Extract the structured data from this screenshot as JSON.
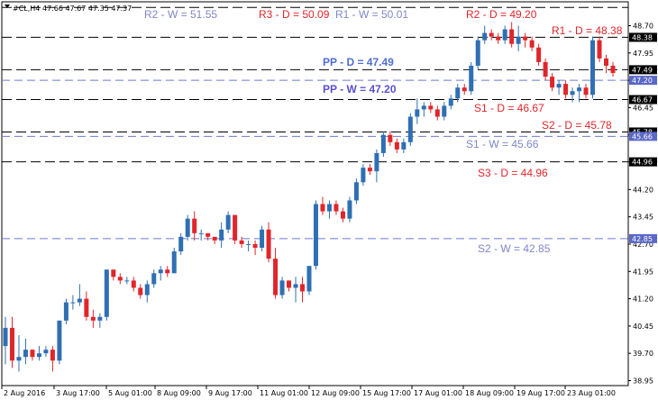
{
  "header": {
    "symbol": "#CL,H4",
    "ohlc": "47.66 47.67 47.35 47.37"
  },
  "colors": {
    "bull": "#2f6fb3",
    "bear": "#e0262b",
    "daily_line": "#000000",
    "weekly_line": "#6b7bd3",
    "daily_text": "#e0262b",
    "weekly_text": "#7f86c9",
    "pp_daily_text": "#4f6fd3",
    "pp_weekly_text": "#5a4fd0",
    "box_fill": "#000000",
    "box_weekly_fill": "#5a68c6"
  },
  "chart_data": {
    "type": "candlestick",
    "symbol": "#CL",
    "timeframe": "H4",
    "ylim": [
      38.95,
      49.1
    ],
    "y_ticks": [
      "48.70",
      "47.95",
      "47.20",
      "46.45",
      "45.70",
      "44.96",
      "44.20",
      "43.45",
      "42.70",
      "41.95",
      "41.20",
      "40.45",
      "39.70",
      "38.95"
    ],
    "x_ticks": [
      "2 Aug 2016",
      "3 Aug 17:00",
      "5 Aug 01:00",
      "8 Aug 09:00",
      "9 Aug 17:00",
      "11 Aug 01:00",
      "12 Aug 09:00",
      "15 Aug 17:00",
      "17 Aug 01:00",
      "18 Aug 09:00",
      "19 Aug 17:00",
      "23 Aug 01:00"
    ],
    "levels": [
      {
        "name": "R2 - W = 51.55",
        "value": 51.55,
        "kind": "weekly",
        "axis_label": ""
      },
      {
        "name": "R3 - D = 50.09",
        "value": 50.09,
        "kind": "daily",
        "axis_label": ""
      },
      {
        "name": "R1 - W = 50.01",
        "value": 50.01,
        "kind": "weekly",
        "axis_label": ""
      },
      {
        "name": "R2 - D = 49.20",
        "value": 49.2,
        "kind": "daily",
        "axis_label": ""
      },
      {
        "name": "R1 - D = 48.38",
        "value": 48.38,
        "kind": "daily",
        "axis_label": "48.38"
      },
      {
        "name": "PP - D = 47.49",
        "value": 47.49,
        "kind": "daily",
        "axis_label": "47.49"
      },
      {
        "name": "PP - W = 47.20",
        "value": 47.2,
        "kind": "weekly",
        "axis_label": "47.20"
      },
      {
        "name": "S1 - D = 46.67",
        "value": 46.67,
        "kind": "daily",
        "axis_label": "46.67"
      },
      {
        "name": "S2 - D = 45.78",
        "value": 45.78,
        "kind": "daily",
        "axis_label": "45.78"
      },
      {
        "name": "S1 - W = 45.66",
        "value": 45.66,
        "kind": "weekly",
        "axis_label": "45.66"
      },
      {
        "name": "S3 - D = 44.96",
        "value": 44.96,
        "kind": "daily",
        "axis_label": "44.96"
      },
      {
        "name": "S2 - W = 42.85",
        "value": 42.85,
        "kind": "weekly",
        "axis_label": "42.85"
      }
    ],
    "candles": [
      [
        39.9,
        40.7,
        39.4,
        40.4
      ],
      [
        40.4,
        40.7,
        39.3,
        39.5
      ],
      [
        39.5,
        40.2,
        39.2,
        39.6
      ],
      [
        39.6,
        40.1,
        39.4,
        39.8
      ],
      [
        39.8,
        39.8,
        39.5,
        39.6
      ],
      [
        39.6,
        39.9,
        39.5,
        39.7
      ],
      [
        39.7,
        39.9,
        39.6,
        39.8
      ],
      [
        39.8,
        39.9,
        39.2,
        39.5
      ],
      [
        39.5,
        40.6,
        39.4,
        40.6
      ],
      [
        40.6,
        41.2,
        40.5,
        41.1
      ],
      [
        41.1,
        41.3,
        40.9,
        41.1
      ],
      [
        41.1,
        41.6,
        41.0,
        41.2
      ],
      [
        41.2,
        41.4,
        40.6,
        40.7
      ],
      [
        40.7,
        40.9,
        40.4,
        40.6
      ],
      [
        40.6,
        40.8,
        40.4,
        40.7
      ],
      [
        40.7,
        42.0,
        40.6,
        42.0
      ],
      [
        42.0,
        42.0,
        41.7,
        41.8
      ],
      [
        41.8,
        41.9,
        41.6,
        41.7
      ],
      [
        41.7,
        41.8,
        41.6,
        41.7
      ],
      [
        41.7,
        41.8,
        41.4,
        41.5
      ],
      [
        41.5,
        41.6,
        41.2,
        41.3
      ],
      [
        41.3,
        41.7,
        41.1,
        41.6
      ],
      [
        41.6,
        42.0,
        41.5,
        41.9
      ],
      [
        41.9,
        42.1,
        41.7,
        42.0
      ],
      [
        42.0,
        42.1,
        41.8,
        41.9
      ],
      [
        41.9,
        42.6,
        41.9,
        42.5
      ],
      [
        42.5,
        43.0,
        42.4,
        42.9
      ],
      [
        42.9,
        43.5,
        42.8,
        43.4
      ],
      [
        43.4,
        43.6,
        42.8,
        43.0
      ],
      [
        43.0,
        43.1,
        42.8,
        43.0
      ],
      [
        43.0,
        43.0,
        42.8,
        42.9
      ],
      [
        42.9,
        42.9,
        42.7,
        42.8
      ],
      [
        42.8,
        43.3,
        42.6,
        43.1
      ],
      [
        43.1,
        43.6,
        43.0,
        43.5
      ],
      [
        43.5,
        43.5,
        42.7,
        42.8
      ],
      [
        42.8,
        42.9,
        42.6,
        42.7
      ],
      [
        42.7,
        42.8,
        42.5,
        42.7
      ],
      [
        42.7,
        42.8,
        42.4,
        42.6
      ],
      [
        42.6,
        43.2,
        42.5,
        43.1
      ],
      [
        43.1,
        43.3,
        42.2,
        42.3
      ],
      [
        42.3,
        42.6,
        41.2,
        41.3
      ],
      [
        41.3,
        41.8,
        41.2,
        41.7
      ],
      [
        41.7,
        41.7,
        41.4,
        41.5
      ],
      [
        41.5,
        41.8,
        41.1,
        41.6
      ],
      [
        41.6,
        41.8,
        41.1,
        41.4
      ],
      [
        41.4,
        42.1,
        41.3,
        42.1
      ],
      [
        42.1,
        43.9,
        42.0,
        43.8
      ],
      [
        43.8,
        44.0,
        43.5,
        43.6
      ],
      [
        43.6,
        43.9,
        43.4,
        43.8
      ],
      [
        43.8,
        43.9,
        43.5,
        43.6
      ],
      [
        43.6,
        43.7,
        43.3,
        43.4
      ],
      [
        43.4,
        44.0,
        43.3,
        43.9
      ],
      [
        43.9,
        44.5,
        43.8,
        44.4
      ],
      [
        44.4,
        44.9,
        44.3,
        44.8
      ],
      [
        44.8,
        44.9,
        44.6,
        44.7
      ],
      [
        44.7,
        45.3,
        44.4,
        45.2
      ],
      [
        45.2,
        45.8,
        45.1,
        45.7
      ],
      [
        45.7,
        45.8,
        45.4,
        45.5
      ],
      [
        45.5,
        45.6,
        45.2,
        45.3
      ],
      [
        45.3,
        45.6,
        45.2,
        45.5
      ],
      [
        45.5,
        46.3,
        45.4,
        46.2
      ],
      [
        46.2,
        46.7,
        46.0,
        46.4
      ],
      [
        46.4,
        46.6,
        46.2,
        46.5
      ],
      [
        46.5,
        46.6,
        46.3,
        46.4
      ],
      [
        46.4,
        46.5,
        46.1,
        46.2
      ],
      [
        46.2,
        46.6,
        46.1,
        46.5
      ],
      [
        46.5,
        46.8,
        46.4,
        46.7
      ],
      [
        46.7,
        47.1,
        46.6,
        47.0
      ],
      [
        47.0,
        47.1,
        46.8,
        46.9
      ],
      [
        46.9,
        47.7,
        46.8,
        47.6
      ],
      [
        47.6,
        48.4,
        47.5,
        48.3
      ],
      [
        48.3,
        48.7,
        48.2,
        48.5
      ],
      [
        48.5,
        48.6,
        48.3,
        48.4
      ],
      [
        48.4,
        48.5,
        48.2,
        48.3
      ],
      [
        48.3,
        48.7,
        48.2,
        48.6
      ],
      [
        48.6,
        48.8,
        48.1,
        48.2
      ],
      [
        48.2,
        48.7,
        48.0,
        48.4
      ],
      [
        48.4,
        48.5,
        48.1,
        48.3
      ],
      [
        48.3,
        48.4,
        48.0,
        48.1
      ],
      [
        48.1,
        48.2,
        47.6,
        47.7
      ],
      [
        47.7,
        47.8,
        47.2,
        47.3
      ],
      [
        47.3,
        47.4,
        46.9,
        47.0
      ],
      [
        47.0,
        47.2,
        46.8,
        47.1
      ],
      [
        47.1,
        47.2,
        46.7,
        46.8
      ],
      [
        46.8,
        47.0,
        46.6,
        46.9
      ],
      [
        46.9,
        47.1,
        46.6,
        47.0
      ],
      [
        47.0,
        47.1,
        46.7,
        46.8
      ],
      [
        46.8,
        48.4,
        46.7,
        48.3
      ],
      [
        48.3,
        48.4,
        47.7,
        47.8
      ],
      [
        47.8,
        47.9,
        47.4,
        47.6
      ],
      [
        47.6,
        47.7,
        47.3,
        47.4
      ]
    ]
  }
}
